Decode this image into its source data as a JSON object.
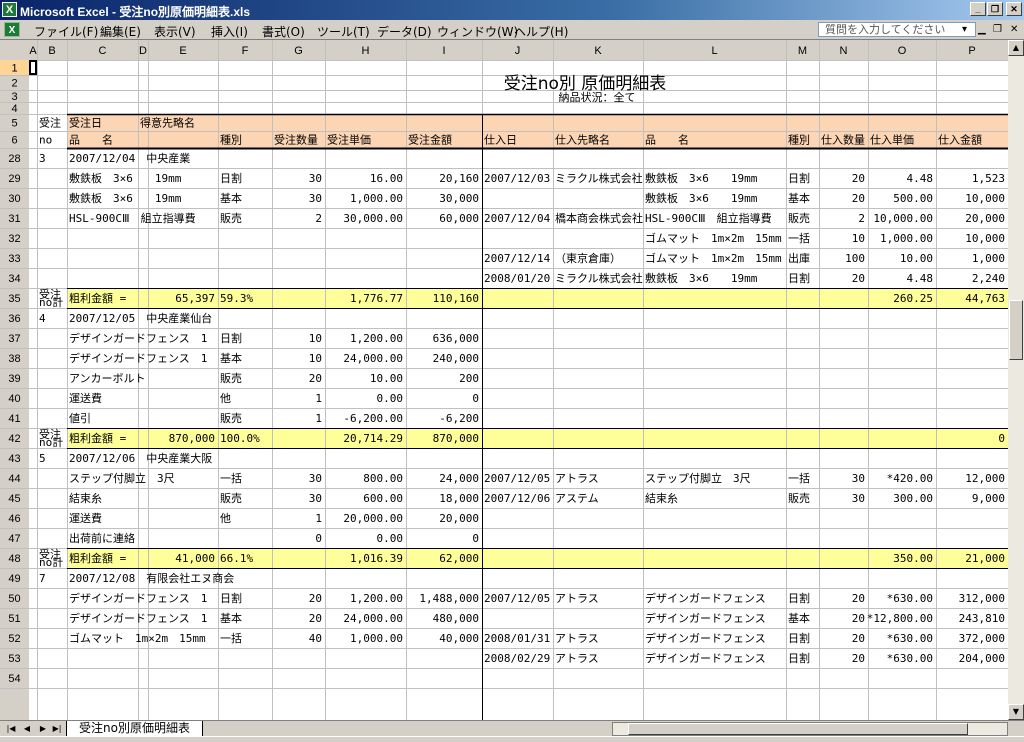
{
  "window": {
    "title": "Microsoft Excel - 受注no別原価明細表.xls"
  },
  "menu": {
    "items": [
      "ファイル(F)",
      "編集(E)",
      "表示(V)",
      "挿入(I)",
      "書式(O)",
      "ツール(T)",
      "データ(D)",
      "ウィンドウ(W)",
      "ヘルプ(H)"
    ],
    "help_placeholder": "質問を入力してください",
    "help_dropdown": "▾",
    "mdi_min": "▁",
    "mdi_restore": "❐",
    "mdi_close": "✕"
  },
  "window_buttons": {
    "min": "_",
    "restore": "❐",
    "close": "✕"
  },
  "grid": {
    "columns": [
      "A",
      "B",
      "C",
      "D",
      "E",
      "F",
      "G",
      "H",
      "I",
      "J",
      "K",
      "L",
      "M",
      "N",
      "O",
      "P"
    ],
    "title": "受注no別 原価明細表",
    "subtitle": "納品状況：全て",
    "header": {
      "r5": {
        "B": "受注",
        "C": "受注日",
        "D": "得意先略名"
      },
      "r6": {
        "B": "no",
        "C": "品　　名",
        "F": "種別",
        "G": "受注数量",
        "H": "受注単価",
        "I": "受注金額",
        "J": "仕入日",
        "K": "仕入先略名",
        "L": "品　　名",
        "M": "種別",
        "N": "仕入数量",
        "O": "仕入単価",
        "P": "仕入金額"
      }
    },
    "rows": [
      {
        "n": "1",
        "cells": {}
      },
      {
        "n": "2",
        "cells": {}
      },
      {
        "n": "3",
        "cells": {}
      },
      {
        "n": "4",
        "cells": {}
      },
      {
        "n": "5",
        "cells": {}
      },
      {
        "n": "6",
        "cells": {}
      },
      {
        "n": "28",
        "cells": {
          "B": "3",
          "C": "2007/12/04　中央産業"
        }
      },
      {
        "n": "29",
        "cells": {
          "C": "敷鉄板　3×6　　19mm",
          "F": "日割",
          "G": "30",
          "H": "16.00",
          "I": "20,160",
          "J": "2007/12/03",
          "K": "ミラクル株式会社",
          "L": "敷鉄板　3×6　　19mm",
          "M": "日割",
          "N": "20",
          "O": "4.48",
          "P": "1,523"
        }
      },
      {
        "n": "30",
        "cells": {
          "C": "敷鉄板　3×6　　19mm",
          "F": "基本",
          "G": "30",
          "H": "1,000.00",
          "I": "30,000",
          "L": "敷鉄板　3×6　　19mm",
          "M": "基本",
          "N": "20",
          "O": "500.00",
          "P": "10,000"
        }
      },
      {
        "n": "31",
        "cells": {
          "C": "HSL-900CⅢ　組立指導費",
          "F": "販売",
          "G": "2",
          "H": "30,000.00",
          "I": "60,000",
          "J": "2007/12/04",
          "K": "橋本商会株式会社",
          "L": "HSL-900CⅢ　組立指導費",
          "M": "販売",
          "N": "2",
          "O": "10,000.00",
          "P": "20,000"
        }
      },
      {
        "n": "32",
        "cells": {
          "L": "ゴムマット　1m×2m　15mm",
          "M": "一括",
          "N": "10",
          "O": "1,000.00",
          "P": "10,000"
        }
      },
      {
        "n": "33",
        "cells": {
          "J": "2007/12/14",
          "K": "（東京倉庫）",
          "L": "ゴムマット　1m×2m　15mm",
          "M": "出庫",
          "N": "100",
          "O": "10.00",
          "P": "1,000"
        }
      },
      {
        "n": "34",
        "cells": {
          "J": "2008/01/20",
          "K": "ミラクル株式会社",
          "L": "敷鉄板　3×6　　19mm",
          "M": "日割",
          "N": "20",
          "O": "4.48",
          "P": "2,240"
        }
      },
      {
        "n": "35",
        "sub": true,
        "cells": {
          "B": "受注",
          "B2": "no計",
          "C": "粗利金額 =",
          "E": "65,397",
          "F": "59.3%",
          "H": "1,776.77",
          "I": "110,160",
          "O": "260.25",
          "P": "44,763"
        }
      },
      {
        "n": "36",
        "cells": {
          "B": "4",
          "C": "2007/12/05　中央産業仙台"
        }
      },
      {
        "n": "37",
        "cells": {
          "C": "デザインガードフェンス　1",
          "F": "日割",
          "G": "10",
          "H": "1,200.00",
          "I": "636,000"
        }
      },
      {
        "n": "38",
        "cells": {
          "C": "デザインガードフェンス　1",
          "F": "基本",
          "G": "10",
          "H": "24,000.00",
          "I": "240,000"
        }
      },
      {
        "n": "39",
        "cells": {
          "C": "アンカーボルト",
          "F": "販売",
          "G": "20",
          "H": "10.00",
          "I": "200"
        }
      },
      {
        "n": "40",
        "cells": {
          "C": "運送費",
          "F": "他",
          "G": "1",
          "H": "0.00",
          "I": "0"
        }
      },
      {
        "n": "41",
        "cells": {
          "C": "値引",
          "F": "販売",
          "G": "1",
          "H": "-6,200.00",
          "I": "-6,200"
        }
      },
      {
        "n": "42",
        "sub": true,
        "cells": {
          "B": "受注",
          "B2": "no計",
          "C": "粗利金額 =",
          "E": "870,000",
          "F": "100.0%",
          "H": "20,714.29",
          "I": "870,000",
          "P": "0"
        }
      },
      {
        "n": "43",
        "cells": {
          "B": "5",
          "C": "2007/12/06　中央産業大阪"
        }
      },
      {
        "n": "44",
        "cells": {
          "C": "ステップ付脚立　3尺",
          "F": "一括",
          "G": "30",
          "H": "800.00",
          "I": "24,000",
          "J": "2007/12/05",
          "K": "アトラス",
          "L": "ステップ付脚立　3尺",
          "M": "一括",
          "N": "30",
          "O": "*420.00",
          "P": "12,000"
        }
      },
      {
        "n": "45",
        "cells": {
          "C": "結束糸",
          "F": "販売",
          "G": "30",
          "H": "600.00",
          "I": "18,000",
          "J": "2007/12/06",
          "K": "アステム",
          "L": "結束糸",
          "M": "販売",
          "N": "30",
          "O": "300.00",
          "P": "9,000"
        }
      },
      {
        "n": "46",
        "cells": {
          "C": "運送費",
          "F": "他",
          "G": "1",
          "H": "20,000.00",
          "I": "20,000"
        }
      },
      {
        "n": "47",
        "cells": {
          "C": "出荷前に連絡",
          "G": "0",
          "H": "0.00",
          "I": "0"
        }
      },
      {
        "n": "48",
        "sub": true,
        "cells": {
          "B": "受注",
          "B2": "no計",
          "C": "粗利金額 =",
          "E": "41,000",
          "F": "66.1%",
          "H": "1,016.39",
          "I": "62,000",
          "O": "350.00",
          "P": "21,000"
        }
      },
      {
        "n": "49",
        "cells": {
          "B": "7",
          "C": "2007/12/08　有限会社エヌ商会"
        }
      },
      {
        "n": "50",
        "cells": {
          "C": "デザインガードフェンス　1",
          "F": "日割",
          "G": "20",
          "H": "1,200.00",
          "I": "1,488,000",
          "J": "2007/12/05",
          "K": "アトラス",
          "L": "デザインガードフェンス",
          "M": "日割",
          "N": "20",
          "O": "*630.00",
          "P": "312,000"
        }
      },
      {
        "n": "51",
        "cells": {
          "C": "デザインガードフェンス　1",
          "F": "基本",
          "G": "20",
          "H": "24,000.00",
          "I": "480,000",
          "L": "デザインガードフェンス",
          "M": "基本",
          "N": "20",
          "O": "*12,800.00",
          "P": "243,810"
        }
      },
      {
        "n": "52",
        "cells": {
          "C": "ゴムマット　1m×2m　15mm",
          "F": "一括",
          "G": "40",
          "H": "1,000.00",
          "I": "40,000",
          "J": "2008/01/31",
          "K": "アトラス",
          "L": "デザインガードフェンス",
          "M": "日割",
          "N": "20",
          "O": "*630.00",
          "P": "372,000"
        }
      },
      {
        "n": "53",
        "cells": {
          "J": "2008/02/29",
          "K": "アトラス",
          "L": "デザインガードフェンス",
          "M": "日割",
          "N": "20",
          "O": "*630.00",
          "P": "204,000"
        }
      },
      {
        "n": "54",
        "cells": {}
      }
    ]
  },
  "sheet": {
    "tab": "受注no別原価明細表",
    "nav": [
      "|◀",
      "◀",
      "▶",
      "▶|"
    ]
  },
  "colors": {
    "header_band": "#fcd5b4",
    "subtotal_band": "#ffff99",
    "title_bar": "#0a246a"
  }
}
